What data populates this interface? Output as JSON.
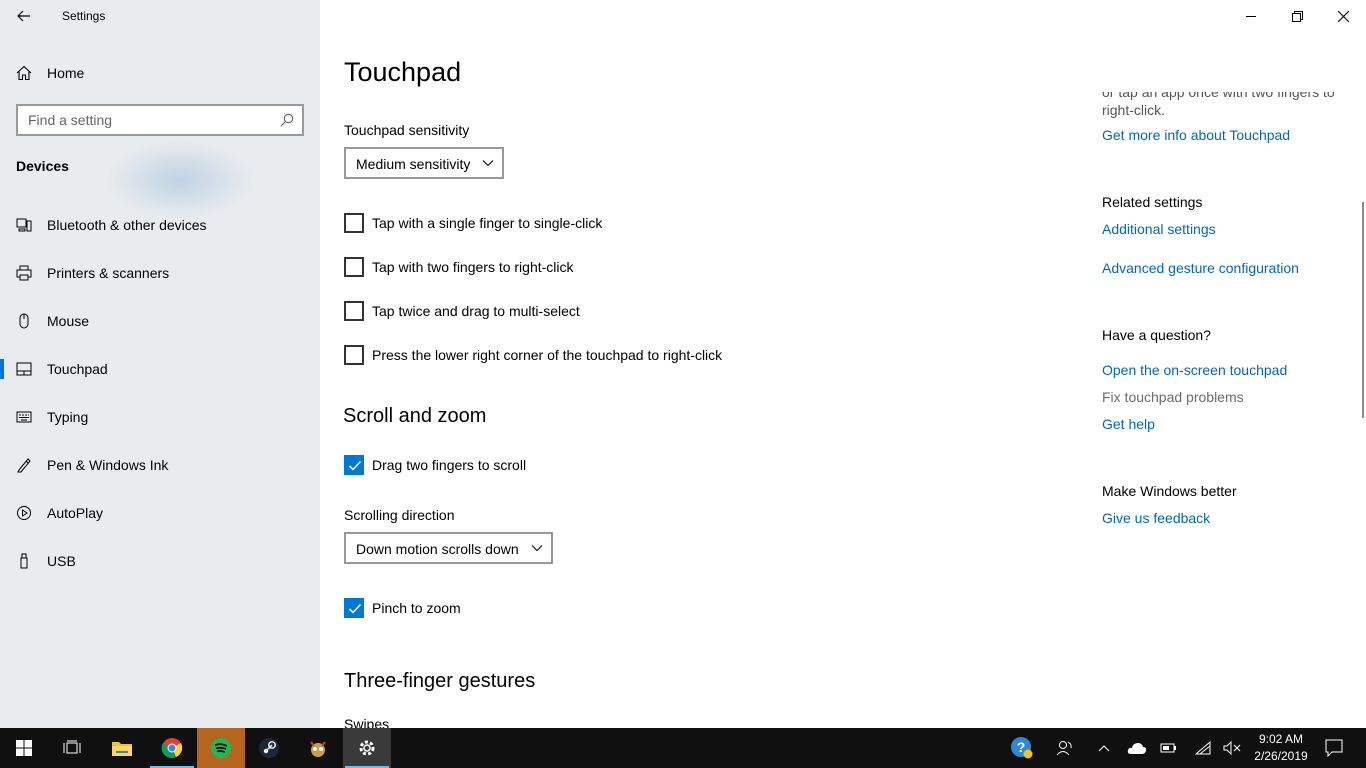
{
  "window": {
    "app_title": "Settings",
    "back_label": "Back",
    "minimize": "Minimize",
    "restore": "Restore",
    "close": "Close"
  },
  "sidebar": {
    "home_label": "Home",
    "search_placeholder": "Find a setting",
    "section": "Devices",
    "items": [
      {
        "label": "Bluetooth & other devices",
        "icon": "bluetooth-devices-icon"
      },
      {
        "label": "Printers & scanners",
        "icon": "printer-icon"
      },
      {
        "label": "Mouse",
        "icon": "mouse-icon"
      },
      {
        "label": "Touchpad",
        "icon": "touchpad-icon",
        "active": true
      },
      {
        "label": "Typing",
        "icon": "keyboard-icon"
      },
      {
        "label": "Pen & Windows Ink",
        "icon": "pen-icon"
      },
      {
        "label": "AutoPlay",
        "icon": "autoplay-icon"
      },
      {
        "label": "USB",
        "icon": "usb-icon"
      }
    ]
  },
  "main": {
    "title": "Touchpad",
    "sensitivity_label": "Touchpad sensitivity",
    "sensitivity_value": "Medium sensitivity",
    "checkboxes": [
      {
        "label": "Tap with a single finger to single-click",
        "checked": false
      },
      {
        "label": "Tap with two fingers to right-click",
        "checked": false
      },
      {
        "label": "Tap twice and drag to multi-select",
        "checked": false
      },
      {
        "label": "Press the lower right corner of the touchpad to right-click",
        "checked": false
      }
    ],
    "scroll_heading": "Scroll and zoom",
    "drag_scroll": {
      "label": "Drag two fingers to scroll",
      "checked": true
    },
    "scroll_direction_label": "Scrolling direction",
    "scroll_direction_value": "Down motion scrolls down",
    "pinch_zoom": {
      "label": "Pinch to zoom",
      "checked": true
    },
    "three_finger_heading": "Three-finger gestures",
    "swipes_label": "Swipes"
  },
  "side": {
    "cut_line_1": "or tap an app once with two fingers to",
    "cut_line_2": "right-click.",
    "more_info_link": "Get more info about Touchpad",
    "related_heading": "Related settings",
    "additional_link": "Additional settings",
    "advanced_link": "Advanced gesture configuration",
    "question_heading": "Have a question?",
    "onscreen_link": "Open the on-screen touchpad",
    "fix_text": "Fix touchpad problems",
    "help_link": "Get help",
    "better_heading": "Make Windows better",
    "feedback_link": "Give us feedback"
  },
  "taskbar": {
    "time": "9:02 AM",
    "date": "2/26/2019",
    "accent": "#0078d7"
  }
}
